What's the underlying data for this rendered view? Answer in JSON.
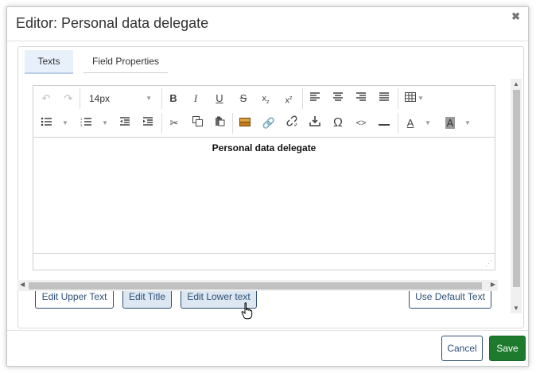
{
  "dialog": {
    "title": "Editor: Personal data delegate",
    "close_icon": "close-icon"
  },
  "tabs": [
    {
      "label": "Texts",
      "active": true
    },
    {
      "label": "Field Properties",
      "active": false
    }
  ],
  "toolbar": {
    "font_size": "14px",
    "text_color_letter": "A",
    "highlight_letter": "A",
    "special_char": "Ω",
    "source": "<>"
  },
  "editor": {
    "content_title": "Personal data delegate"
  },
  "buttons": {
    "edit_upper": "Edit Upper Text",
    "edit_title": "Edit Title",
    "edit_lower": "Edit Lower text",
    "use_default": "Use Default Text"
  },
  "footer": {
    "cancel": "Cancel",
    "save": "Save"
  },
  "colors": {
    "accent": "#2d4f77",
    "save": "#1e7b2e"
  }
}
